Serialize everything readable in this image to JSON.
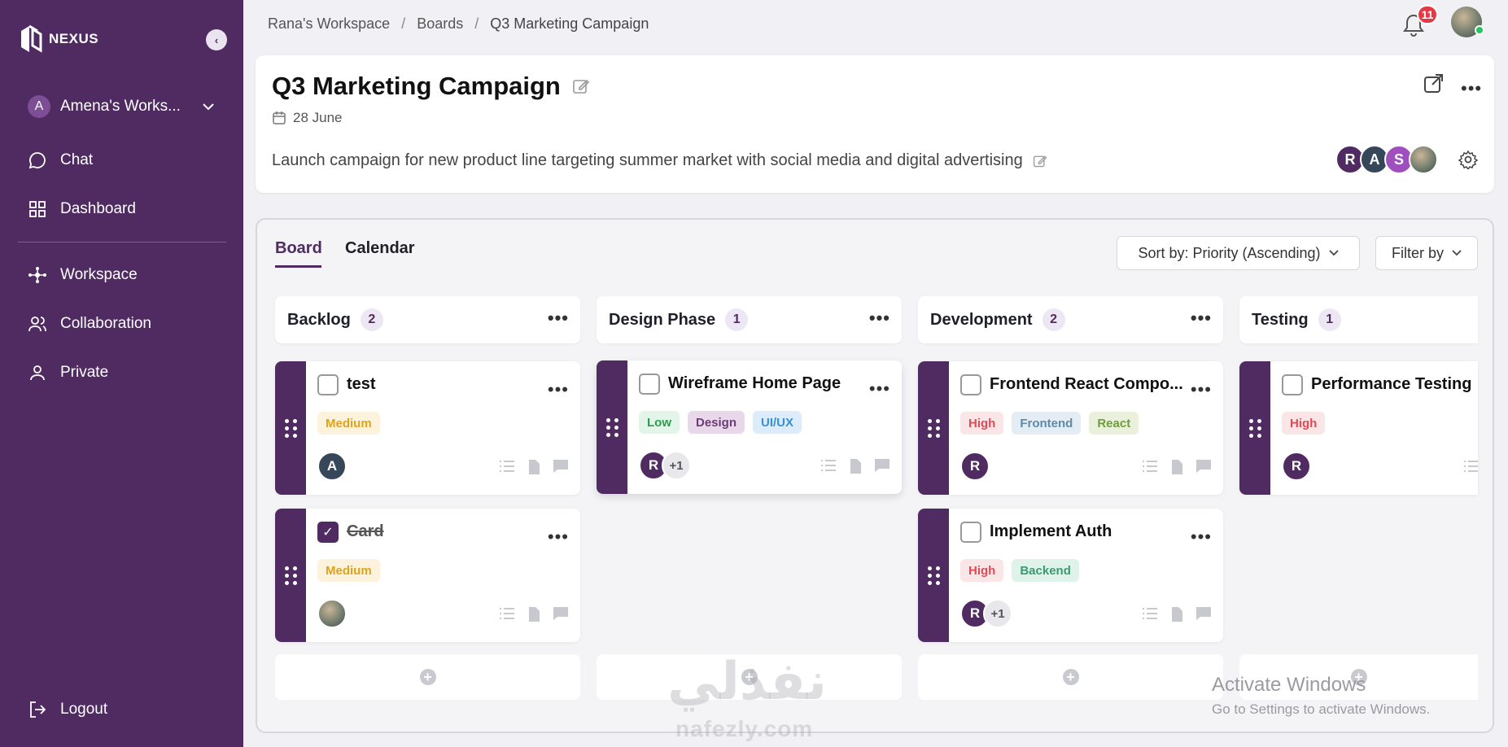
{
  "brand": {
    "name": "NEXUS"
  },
  "sidebar": {
    "workspace": {
      "initial": "A",
      "name": "Amena's Works..."
    },
    "items": [
      {
        "label": "Chat",
        "icon": "chat-icon"
      },
      {
        "label": "Dashboard",
        "icon": "dashboard-icon"
      },
      {
        "label": "Workspace",
        "icon": "workspace-icon"
      },
      {
        "label": "Collaboration",
        "icon": "users-icon"
      },
      {
        "label": "Private",
        "icon": "user-icon"
      }
    ],
    "logout": "Logout"
  },
  "breadcrumb": [
    "Rana's Workspace",
    "Boards",
    "Q3 Marketing Campaign"
  ],
  "notifications": {
    "count": "11"
  },
  "board": {
    "title": "Q3 Marketing Campaign",
    "date": "28 June",
    "description": "Launch campaign for new product line targeting summer market with social media and digital advertising",
    "members": [
      "R",
      "A",
      "S"
    ]
  },
  "tabs": [
    "Board",
    "Calendar"
  ],
  "toolbar": {
    "sort": "Sort by: Priority (Ascending)",
    "filter": "Filter by"
  },
  "columns": [
    {
      "name": "Backlog",
      "count": "2"
    },
    {
      "name": "Design Phase",
      "count": "1"
    },
    {
      "name": "Development",
      "count": "2"
    },
    {
      "name": "Testing",
      "count": "1"
    }
  ],
  "tasks": {
    "backlog_1": {
      "title": "test",
      "tags": [
        "Medium"
      ],
      "assignees": [
        "A"
      ]
    },
    "backlog_2": {
      "title": "Card",
      "tags": [
        "Medium"
      ],
      "done": true
    },
    "design_1": {
      "title": "Wireframe Home Page",
      "tags": [
        "Low",
        "Design",
        "UI/UX"
      ],
      "assignees": [
        "R"
      ],
      "more": "+1"
    },
    "dev_1": {
      "title": "Frontend React Compo...",
      "tags": [
        "High",
        "Frontend",
        "React"
      ],
      "assignees": [
        "R"
      ]
    },
    "dev_2": {
      "title": "Implement Auth",
      "tags": [
        "High",
        "Backend"
      ],
      "assignees": [
        "R"
      ],
      "more": "+1"
    },
    "test_1": {
      "title": "Performance Testing",
      "tags": [
        "High"
      ],
      "assignees": [
        "R"
      ]
    }
  },
  "watermark": {
    "main": "نفذلي",
    "sub": "nafezly.com"
  },
  "os_notice": {
    "line1": "Activate Windows",
    "line2": "Go to Settings to activate Windows."
  },
  "colors": {
    "sidebar": "#4f2b61",
    "accent": "#4f2b61",
    "badge": "#e63946"
  }
}
